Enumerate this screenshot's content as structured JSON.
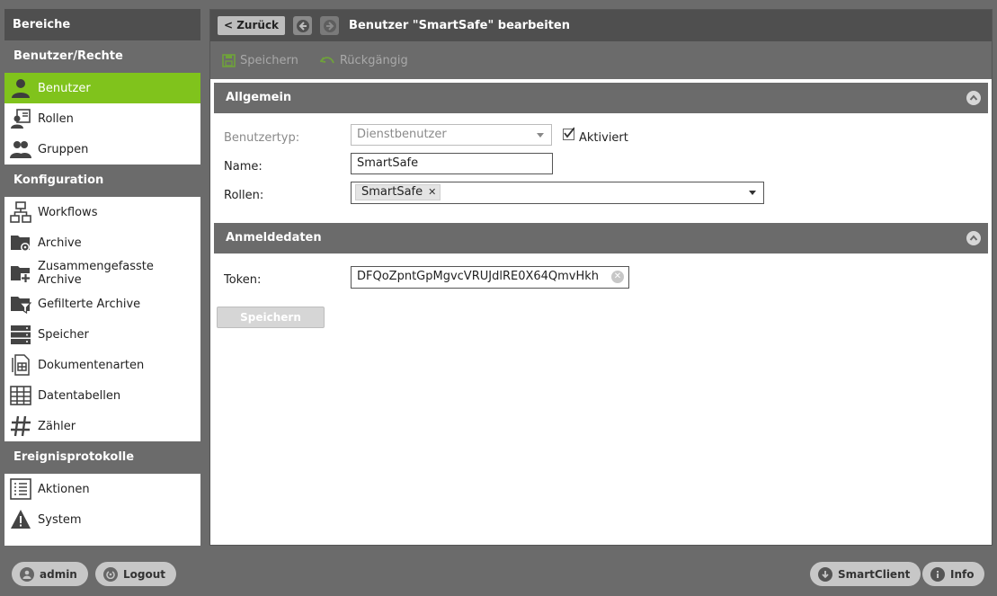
{
  "sidebar": {
    "title": "Bereiche",
    "groups": [
      {
        "label": "Benutzer/Rechte"
      },
      {
        "label": "Konfiguration"
      },
      {
        "label": "Ereignisprotokolle"
      }
    ],
    "items": {
      "benutzer": "Benutzer",
      "rollen": "Rollen",
      "gruppen": "Gruppen",
      "workflows": "Workflows",
      "archive": "Archive",
      "zusammengefasste_archive": "Zusammengefasste Archive",
      "gefilterte_archive": "Gefilterte Archive",
      "speicher": "Speicher",
      "dokumentenarten": "Dokumentenarten",
      "datentabellen": "Datentabellen",
      "zaehler": "Zähler",
      "aktionen": "Aktionen",
      "system": "System"
    },
    "active_color": "#80c31c"
  },
  "header": {
    "back_label": "< Zurück",
    "title": "Benutzer \"SmartSafe\" bearbeiten"
  },
  "toolbar": {
    "save_label": "Speichern",
    "undo_label": "Rückgängig"
  },
  "sections": {
    "general": {
      "title": "Allgemein",
      "user_type_label": "Benutzertyp:",
      "user_type_value": "Dienstbenutzer",
      "activated_label": "Aktiviert",
      "name_label": "Name:",
      "name_value": "SmartSafe",
      "roles_label": "Rollen:",
      "roles_tag": "SmartSafe"
    },
    "credentials": {
      "title": "Anmeldedaten",
      "token_label": "Token:",
      "token_value": "DFQoZpntGpMgvcVRUJdlRE0X64QmvHkh"
    }
  },
  "form": {
    "save_button": "Speichern"
  },
  "footer": {
    "user": "admin",
    "logout": "Logout",
    "smartclient": "SmartClient",
    "info": "Info"
  }
}
